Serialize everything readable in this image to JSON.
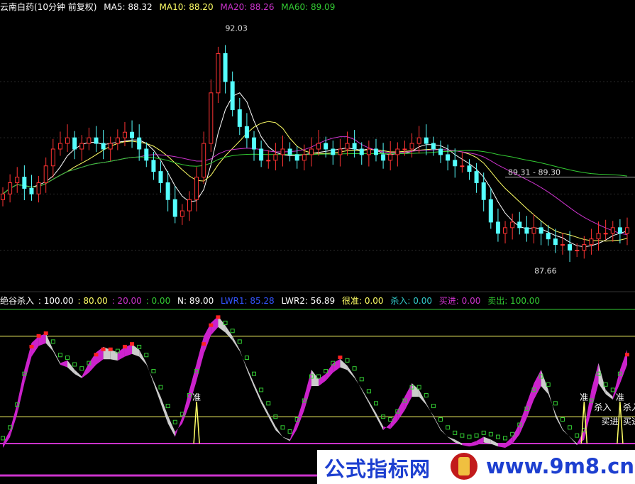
{
  "header_top": {
    "name": "云南白药(10分钟 前复权)",
    "items": [
      {
        "label": "MA5: 88.32",
        "color": "#ffffff"
      },
      {
        "label": "MA10: 88.20",
        "color": "#ffff66"
      },
      {
        "label": "MA20: 88.26",
        "color": "#cc33cc"
      },
      {
        "label": "MA60: 89.09",
        "color": "#33cc33"
      }
    ]
  },
  "header_bottom": {
    "name": "绝谷杀入",
    "items": [
      {
        "label": ": 100.00",
        "color": "#ffffff"
      },
      {
        "label": ": 80.00",
        "color": "#ffff66"
      },
      {
        "label": ": 20.00",
        "color": "#cc33cc"
      },
      {
        "label": ": 0.00",
        "color": "#33cc33"
      },
      {
        "label": "N: 89.00",
        "color": "#ffffff"
      },
      {
        "label": "LWR1: 85.28",
        "color": "#3355ff"
      },
      {
        "label": "LWR2: 56.89",
        "color": "#ffffff"
      },
      {
        "label": "很准: 0.00",
        "color": "#ffff66"
      },
      {
        "label": "杀入: 0.00",
        "color": "#33cccc"
      },
      {
        "label": "买进: 0.00",
        "color": "#cc33cc"
      },
      {
        "label": "卖出: 100.00",
        "color": "#33cc33"
      }
    ]
  },
  "annotations": {
    "high": "92.03",
    "low": "87.66",
    "level": "89.31 - 89.30"
  },
  "signals": [
    {
      "label": "准"
    },
    {
      "label": "准"
    },
    {
      "label": "杀入"
    },
    {
      "label": "买进"
    },
    {
      "label": "准"
    },
    {
      "label": "杀入"
    },
    {
      "label": "买进"
    }
  ],
  "watermark": {
    "logo": "公式指标网",
    "site": "www.9m8.cn"
  },
  "chart_data": [
    {
      "type": "candlestick",
      "ylim": [
        87.4,
        92.2
      ],
      "ma_series": [
        {
          "name": "MA5",
          "color": "#ffffff"
        },
        {
          "name": "MA10",
          "color": "#ffff66"
        },
        {
          "name": "MA20",
          "color": "#cc33cc"
        },
        {
          "name": "MA60",
          "color": "#33cc33"
        }
      ],
      "high_marker": 92.03,
      "low_marker": 87.66,
      "level_line": 89.3,
      "close": [
        89.0,
        89.2,
        89.3,
        89.1,
        89.0,
        89.2,
        89.5,
        89.8,
        89.9,
        90.0,
        89.8,
        89.9,
        90.0,
        89.9,
        89.8,
        89.9,
        90.0,
        90.1,
        90.0,
        89.8,
        89.6,
        89.4,
        89.2,
        88.9,
        88.6,
        88.7,
        88.9,
        89.3,
        89.9,
        90.8,
        91.5,
        91.0,
        90.5,
        90.2,
        90.0,
        89.8,
        89.6,
        89.6,
        89.7,
        89.8,
        89.7,
        89.6,
        89.7,
        89.8,
        89.9,
        89.8,
        89.7,
        89.8,
        89.9,
        89.8,
        89.7,
        89.8,
        89.7,
        89.6,
        89.7,
        89.8,
        89.8,
        89.9,
        90.0,
        89.9,
        89.8,
        89.7,
        89.6,
        89.5,
        89.5,
        89.4,
        89.2,
        88.9,
        88.5,
        88.3,
        88.4,
        88.5,
        88.4,
        88.3,
        88.4,
        88.3,
        88.2,
        88.1,
        88.1,
        88.0,
        88.0,
        88.1,
        88.2,
        88.3,
        88.3,
        88.4,
        88.3,
        88.4
      ]
    },
    {
      "type": "line",
      "ylim": [
        0,
        100
      ],
      "levels": [
        100,
        80,
        20,
        0
      ],
      "series": [
        {
          "name": "LWR1",
          "values": [
            0,
            10,
            30,
            55,
            75,
            80,
            82,
            70,
            60,
            62,
            55,
            50,
            60,
            68,
            72,
            70,
            68,
            72,
            74,
            70,
            60,
            45,
            30,
            15,
            5,
            20,
            40,
            60,
            80,
            90,
            95,
            88,
            80,
            70,
            55,
            42,
            30,
            20,
            10,
            5,
            3,
            18,
            35,
            55,
            48,
            52,
            60,
            63,
            58,
            50,
            40,
            30,
            20,
            10,
            15,
            25,
            35,
            45,
            40,
            30,
            20,
            10,
            5,
            3,
            0,
            0,
            2,
            5,
            3,
            0,
            0,
            5,
            15,
            30,
            45,
            55,
            40,
            20,
            10,
            5,
            0,
            10,
            40,
            60,
            40,
            35,
            55,
            70
          ]
        },
        {
          "name": "LWR2",
          "values": [
            0,
            8,
            25,
            48,
            68,
            76,
            78,
            72,
            62,
            60,
            55,
            52,
            56,
            62,
            66,
            66,
            65,
            68,
            70,
            68,
            62,
            50,
            38,
            24,
            12,
            18,
            32,
            50,
            70,
            84,
            90,
            86,
            80,
            72,
            60,
            48,
            36,
            26,
            16,
            8,
            5,
            14,
            28,
            46,
            46,
            50,
            56,
            60,
            58,
            52,
            44,
            35,
            26,
            16,
            14,
            20,
            28,
            38,
            38,
            32,
            24,
            14,
            8,
            4,
            2,
            1,
            2,
            4,
            3,
            1,
            0,
            3,
            10,
            22,
            36,
            46,
            40,
            26,
            14,
            8,
            2,
            6,
            28,
            48,
            40,
            36,
            48,
            62
          ]
        }
      ]
    }
  ]
}
